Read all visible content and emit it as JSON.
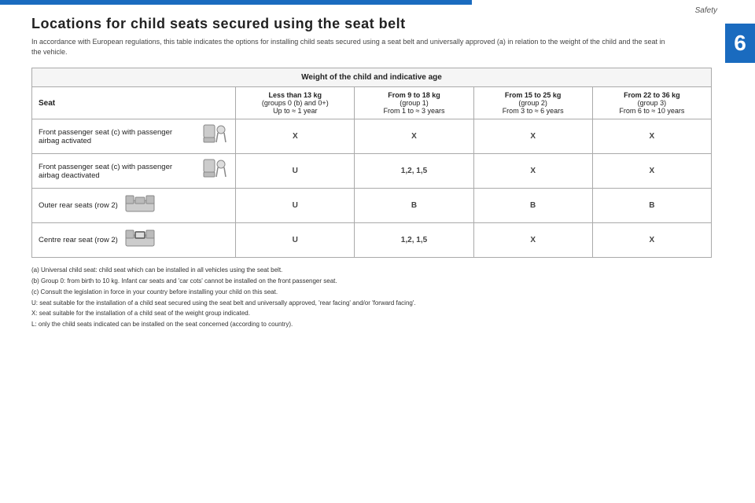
{
  "top": {
    "safety_label": "Safety",
    "chapter_number": "6"
  },
  "title": "Locations for child seats secured using the seat belt",
  "subtitle": "In accordance with European regulations, this table indicates the options for installing child seats secured using a seat belt and universally approved (a) in relation to the weight of the child and the seat in the vehicle.",
  "table": {
    "weight_header": "Weight of the child and indicative age",
    "seat_col_header": "Seat",
    "weight_cols": [
      {
        "label": "Less than 13 kg",
        "sublabel": "(groups 0 (b) and 0+)",
        "sublabel2": "Up to ≈ 1 year"
      },
      {
        "label": "From 9 to 18 kg",
        "sublabel": "(group 1)",
        "sublabel2": "From 1 to ≈ 3 years"
      },
      {
        "label": "From 15 to 25 kg",
        "sublabel": "(group 2)",
        "sublabel2": "From 3 to ≈ 6 years"
      },
      {
        "label": "From 22 to 36 kg",
        "sublabel": "(group 3)",
        "sublabel2": "From 6 to ≈ 10 years"
      }
    ],
    "rows": [
      {
        "seat_name": "Front passenger seat (c) with passenger airbag activated",
        "values": [
          "X",
          "X",
          "X",
          "X"
        ]
      },
      {
        "seat_name": "Front passenger seat (c) with passenger airbag deactivated",
        "values": [
          "U",
          "1,2, 1,5",
          "X",
          "X"
        ]
      },
      {
        "seat_name": "Outer rear seats (row 2)",
        "values": [
          "U",
          "B",
          "B",
          "B"
        ]
      },
      {
        "seat_name": "Centre rear seat (row 2)",
        "values": [
          "U",
          "1,2, 1,5",
          "X",
          "X"
        ]
      }
    ]
  },
  "footnotes": [
    "(a) Universal child seat: child seat which can be installed in all vehicles using the seat belt.",
    "(b) Group 0: from birth to 10 kg. Infant car seats and 'car cots' cannot be installed on the front passenger seat.",
    "(c) Consult the legislation in force in your country before installing your child on this seat.",
    "U: seat suitable for the installation of a child seat secured using the seat belt and universally approved, 'rear facing' and/or 'forward facing'.",
    "X: seat suitable for the installation of a child seat of the weight group indicated.",
    "L: only the child seats indicated can be installed on the seat concerned (according to country)."
  ]
}
